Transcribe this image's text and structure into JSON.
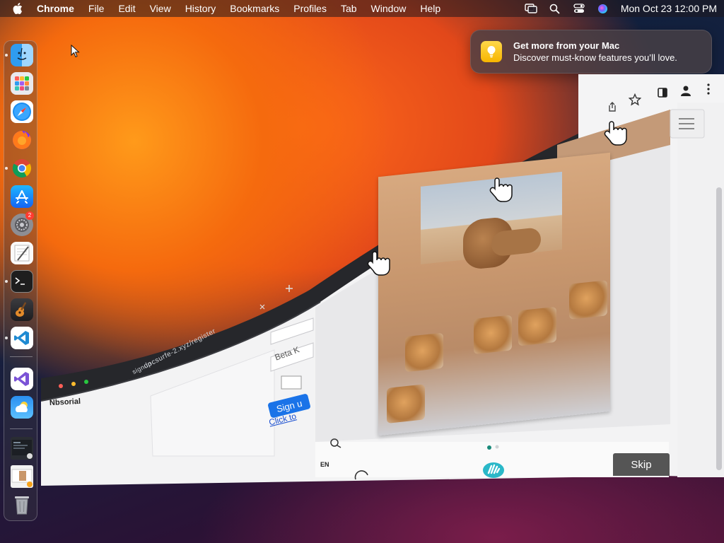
{
  "menubar": {
    "app_name": "Chrome",
    "items": [
      "File",
      "Edit",
      "View",
      "History",
      "Bookmarks",
      "Profiles",
      "Tab",
      "Window",
      "Help"
    ],
    "clock": "Mon Oct 23  12:00 PM"
  },
  "notification": {
    "title": "Get more from your Mac",
    "subtitle": "Discover must-know features you’ll love."
  },
  "dock": {
    "items": [
      {
        "name": "finder-icon"
      },
      {
        "name": "launchpad-icon"
      },
      {
        "name": "safari-icon"
      },
      {
        "name": "firefox-icon"
      },
      {
        "name": "chrome-icon"
      },
      {
        "name": "app-store-icon"
      },
      {
        "name": "system-settings-icon",
        "badge": "2"
      },
      {
        "name": "textedit-icon"
      },
      {
        "name": "terminal-icon"
      },
      {
        "name": "garageband-icon"
      },
      {
        "name": "vscode-icon"
      },
      {
        "name": "visual-studio-icon"
      },
      {
        "name": "weather-icon"
      },
      {
        "name": "window-thumbnail-icon"
      },
      {
        "name": "image-thumbnail-icon"
      },
      {
        "name": "trash-icon"
      }
    ]
  },
  "browser": {
    "address_text": "docsurfe-2.xyz/register",
    "tab_label": "signup",
    "field_text": "Beta K",
    "signup_label": "Sign u",
    "click_link": "Click to",
    "left_label": "Nbsorial",
    "lang_label": "EN",
    "skip_label": "Skip"
  },
  "colors": {
    "accent_blue": "#1a73e8",
    "skip_bg": "#555555",
    "notification_icon": "#f7b500"
  }
}
